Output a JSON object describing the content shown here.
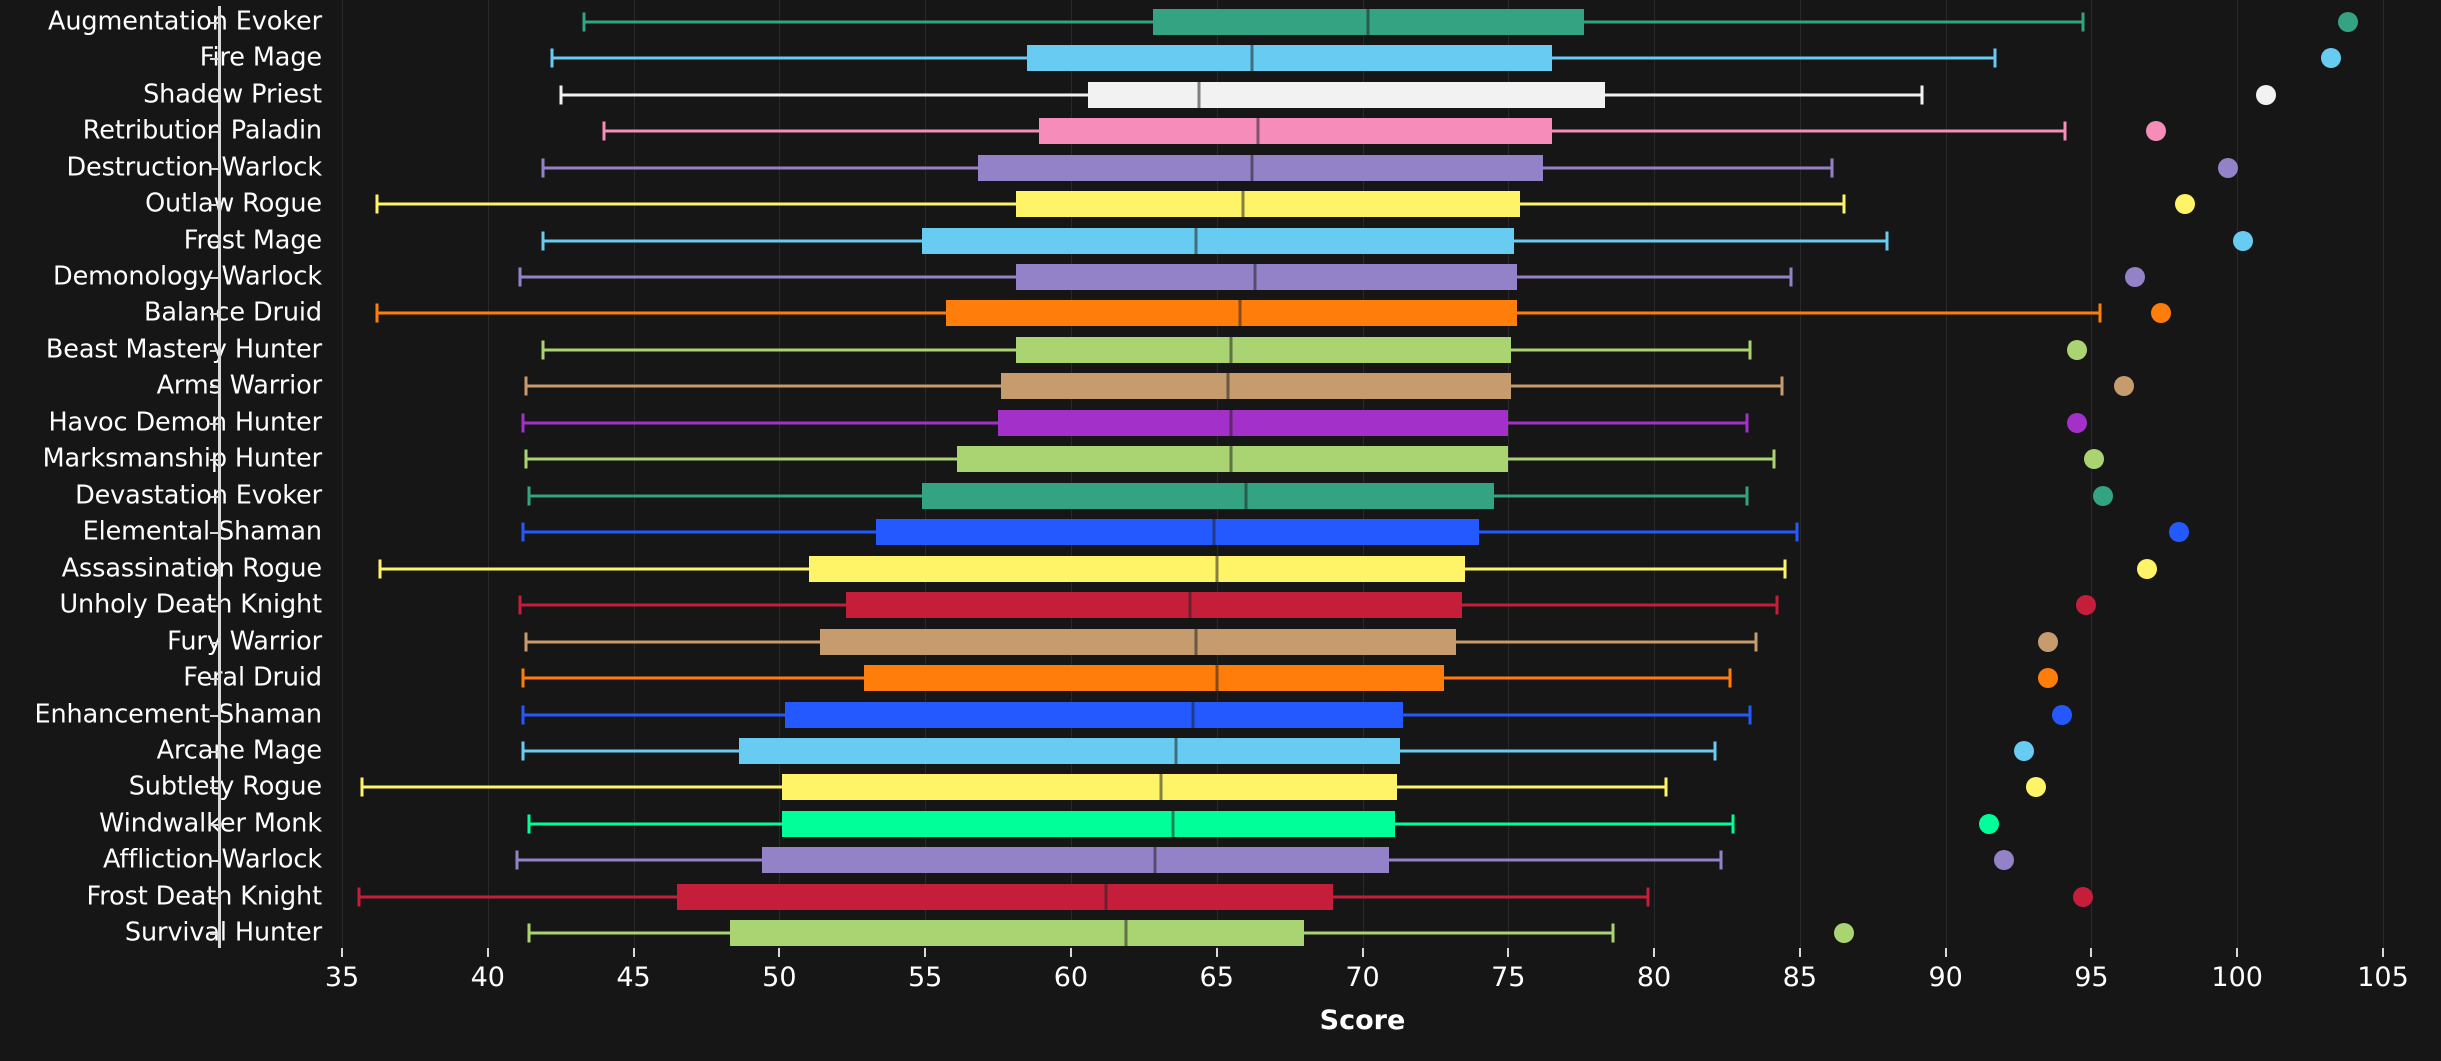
{
  "chart_data": {
    "type": "box",
    "title": "",
    "xlabel": "Score",
    "ylabel": "",
    "xlim": [
      35,
      105
    ],
    "xticks": [
      35,
      40,
      45,
      50,
      55,
      60,
      65,
      70,
      75,
      80,
      85,
      90,
      95,
      100,
      105
    ],
    "xticklabels": [
      "35",
      "40",
      "45",
      "50",
      "55",
      "60",
      "65",
      "70",
      "75",
      "80",
      "85",
      "90",
      "95",
      "100",
      "105"
    ],
    "grid": true,
    "orientation": "horizontal",
    "legend": "none",
    "background": "#161616",
    "categories": [
      "Augmentation Evoker",
      "Fire Mage",
      "Shadow Priest",
      "Retribution Paladin",
      "Destruction Warlock",
      "Outlaw Rogue",
      "Frost Mage",
      "Demonology Warlock",
      "Balance Druid",
      "Beast Mastery Hunter",
      "Arms Warrior",
      "Havoc Demon Hunter",
      "Marksmanship Hunter",
      "Devastation Evoker",
      "Elemental Shaman",
      "Assassination Rogue",
      "Unholy Death Knight",
      "Fury Warrior",
      "Feral Druid",
      "Enhancement Shaman",
      "Arcane Mage",
      "Subtlety Rogue",
      "Windwalker Monk",
      "Affliction Warlock",
      "Frost Death Knight",
      "Survival Hunter"
    ],
    "boxes": [
      {
        "label": "Augmentation Evoker",
        "color": "#33a382",
        "whisker_low": 43.3,
        "q1": 62.8,
        "median": 70.2,
        "q3": 77.6,
        "whisker_high": 94.7,
        "outliers": [
          103.8
        ]
      },
      {
        "label": "Fire Mage",
        "color": "#68ccf2",
        "whisker_low": 42.2,
        "q1": 58.5,
        "median": 66.2,
        "q3": 76.5,
        "whisker_high": 91.7,
        "outliers": [
          103.2
        ]
      },
      {
        "label": "Shadow Priest",
        "color": "#f2f2f2",
        "whisker_low": 42.5,
        "q1": 60.6,
        "median": 64.4,
        "q3": 78.3,
        "whisker_high": 89.2,
        "outliers": [
          101.0
        ]
      },
      {
        "label": "Retribution Paladin",
        "color": "#f58cba",
        "whisker_low": 44.0,
        "q1": 58.9,
        "median": 66.4,
        "q3": 76.5,
        "whisker_high": 94.1,
        "outliers": [
          97.2
        ]
      },
      {
        "label": "Destruction Warlock",
        "color": "#9482c9",
        "whisker_low": 41.9,
        "q1": 56.8,
        "median": 66.2,
        "q3": 76.2,
        "whisker_high": 86.1,
        "outliers": [
          99.7
        ]
      },
      {
        "label": "Outlaw Rogue",
        "color": "#fff468",
        "whisker_low": 36.2,
        "q1": 58.1,
        "median": 65.9,
        "q3": 75.4,
        "whisker_high": 86.5,
        "outliers": [
          98.2
        ]
      },
      {
        "label": "Frost Mage",
        "color": "#68ccf2",
        "whisker_low": 41.9,
        "q1": 54.9,
        "median": 64.3,
        "q3": 75.2,
        "whisker_high": 88.0,
        "outliers": [
          100.2
        ]
      },
      {
        "label": "Demonology Warlock",
        "color": "#9482c9",
        "whisker_low": 41.1,
        "q1": 58.1,
        "median": 66.3,
        "q3": 75.3,
        "whisker_high": 84.7,
        "outliers": [
          96.5
        ]
      },
      {
        "label": "Balance Druid",
        "color": "#ff7d0a",
        "whisker_low": 36.2,
        "q1": 55.7,
        "median": 65.8,
        "q3": 75.3,
        "whisker_high": 95.3,
        "outliers": [
          97.4
        ]
      },
      {
        "label": "Beast Mastery Hunter",
        "color": "#aad372",
        "whisker_low": 41.9,
        "q1": 58.1,
        "median": 65.5,
        "q3": 75.1,
        "whisker_high": 83.3,
        "outliers": [
          94.5
        ]
      },
      {
        "label": "Arms Warrior",
        "color": "#c69b6d",
        "whisker_low": 41.3,
        "q1": 57.6,
        "median": 65.4,
        "q3": 75.1,
        "whisker_high": 84.4,
        "outliers": [
          96.1
        ]
      },
      {
        "label": "Havoc Demon Hunter",
        "color": "#a330c9",
        "whisker_low": 41.2,
        "q1": 57.5,
        "median": 65.5,
        "q3": 75.0,
        "whisker_high": 83.2,
        "outliers": [
          94.5
        ]
      },
      {
        "label": "Marksmanship Hunter",
        "color": "#aad372",
        "whisker_low": 41.3,
        "q1": 56.1,
        "median": 65.5,
        "q3": 75.0,
        "whisker_high": 84.1,
        "outliers": [
          95.1
        ]
      },
      {
        "label": "Devastation Evoker",
        "color": "#33a382",
        "whisker_low": 41.4,
        "q1": 54.9,
        "median": 66.0,
        "q3": 74.5,
        "whisker_high": 83.2,
        "outliers": [
          95.4
        ]
      },
      {
        "label": "Elemental Shaman",
        "color": "#2459ff",
        "whisker_low": 41.2,
        "q1": 53.3,
        "median": 64.9,
        "q3": 74.0,
        "whisker_high": 84.9,
        "outliers": [
          98.0
        ]
      },
      {
        "label": "Assassination Rogue",
        "color": "#fff468",
        "whisker_low": 36.3,
        "q1": 51.0,
        "median": 65.0,
        "q3": 73.5,
        "whisker_high": 84.5,
        "outliers": [
          96.9
        ]
      },
      {
        "label": "Unholy Death Knight",
        "color": "#c41e3a",
        "whisker_low": 41.1,
        "q1": 52.3,
        "median": 64.1,
        "q3": 73.4,
        "whisker_high": 84.2,
        "outliers": [
          94.8
        ]
      },
      {
        "label": "Fury Warrior",
        "color": "#c69b6d",
        "whisker_low": 41.3,
        "q1": 51.4,
        "median": 64.3,
        "q3": 73.2,
        "whisker_high": 83.5,
        "outliers": [
          93.5
        ]
      },
      {
        "label": "Feral Druid",
        "color": "#ff7d0a",
        "whisker_low": 41.2,
        "q1": 52.9,
        "median": 65.0,
        "q3": 72.8,
        "whisker_high": 82.6,
        "outliers": [
          93.5
        ]
      },
      {
        "label": "Enhancement Shaman",
        "color": "#2459ff",
        "whisker_low": 41.2,
        "q1": 50.2,
        "median": 64.2,
        "q3": 71.4,
        "whisker_high": 83.3,
        "outliers": [
          94.0
        ]
      },
      {
        "label": "Arcane Mage",
        "color": "#68ccf2",
        "whisker_low": 41.2,
        "q1": 48.6,
        "median": 63.6,
        "q3": 71.3,
        "whisker_high": 82.1,
        "outliers": [
          92.7
        ]
      },
      {
        "label": "Subtlety Rogue",
        "color": "#fff468",
        "whisker_low": 35.7,
        "q1": 50.1,
        "median": 63.1,
        "q3": 71.2,
        "whisker_high": 80.4,
        "outliers": [
          93.1
        ]
      },
      {
        "label": "Windwalker Monk",
        "color": "#00ff98",
        "whisker_low": 41.4,
        "q1": 50.1,
        "median": 63.5,
        "q3": 71.1,
        "whisker_high": 82.7,
        "outliers": [
          91.5
        ]
      },
      {
        "label": "Affliction Warlock",
        "color": "#9482c9",
        "whisker_low": 41.0,
        "q1": 49.4,
        "median": 62.9,
        "q3": 70.9,
        "whisker_high": 82.3,
        "outliers": [
          92.0
        ]
      },
      {
        "label": "Frost Death Knight",
        "color": "#c41e3a",
        "whisker_low": 35.6,
        "q1": 46.5,
        "median": 61.2,
        "q3": 69.0,
        "whisker_high": 79.8,
        "outliers": [
          94.7
        ]
      },
      {
        "label": "Survival Hunter",
        "color": "#aad372",
        "whisker_low": 41.4,
        "q1": 48.3,
        "median": 61.9,
        "q3": 68.0,
        "whisker_high": 78.6,
        "outliers": [
          86.5
        ]
      }
    ]
  }
}
